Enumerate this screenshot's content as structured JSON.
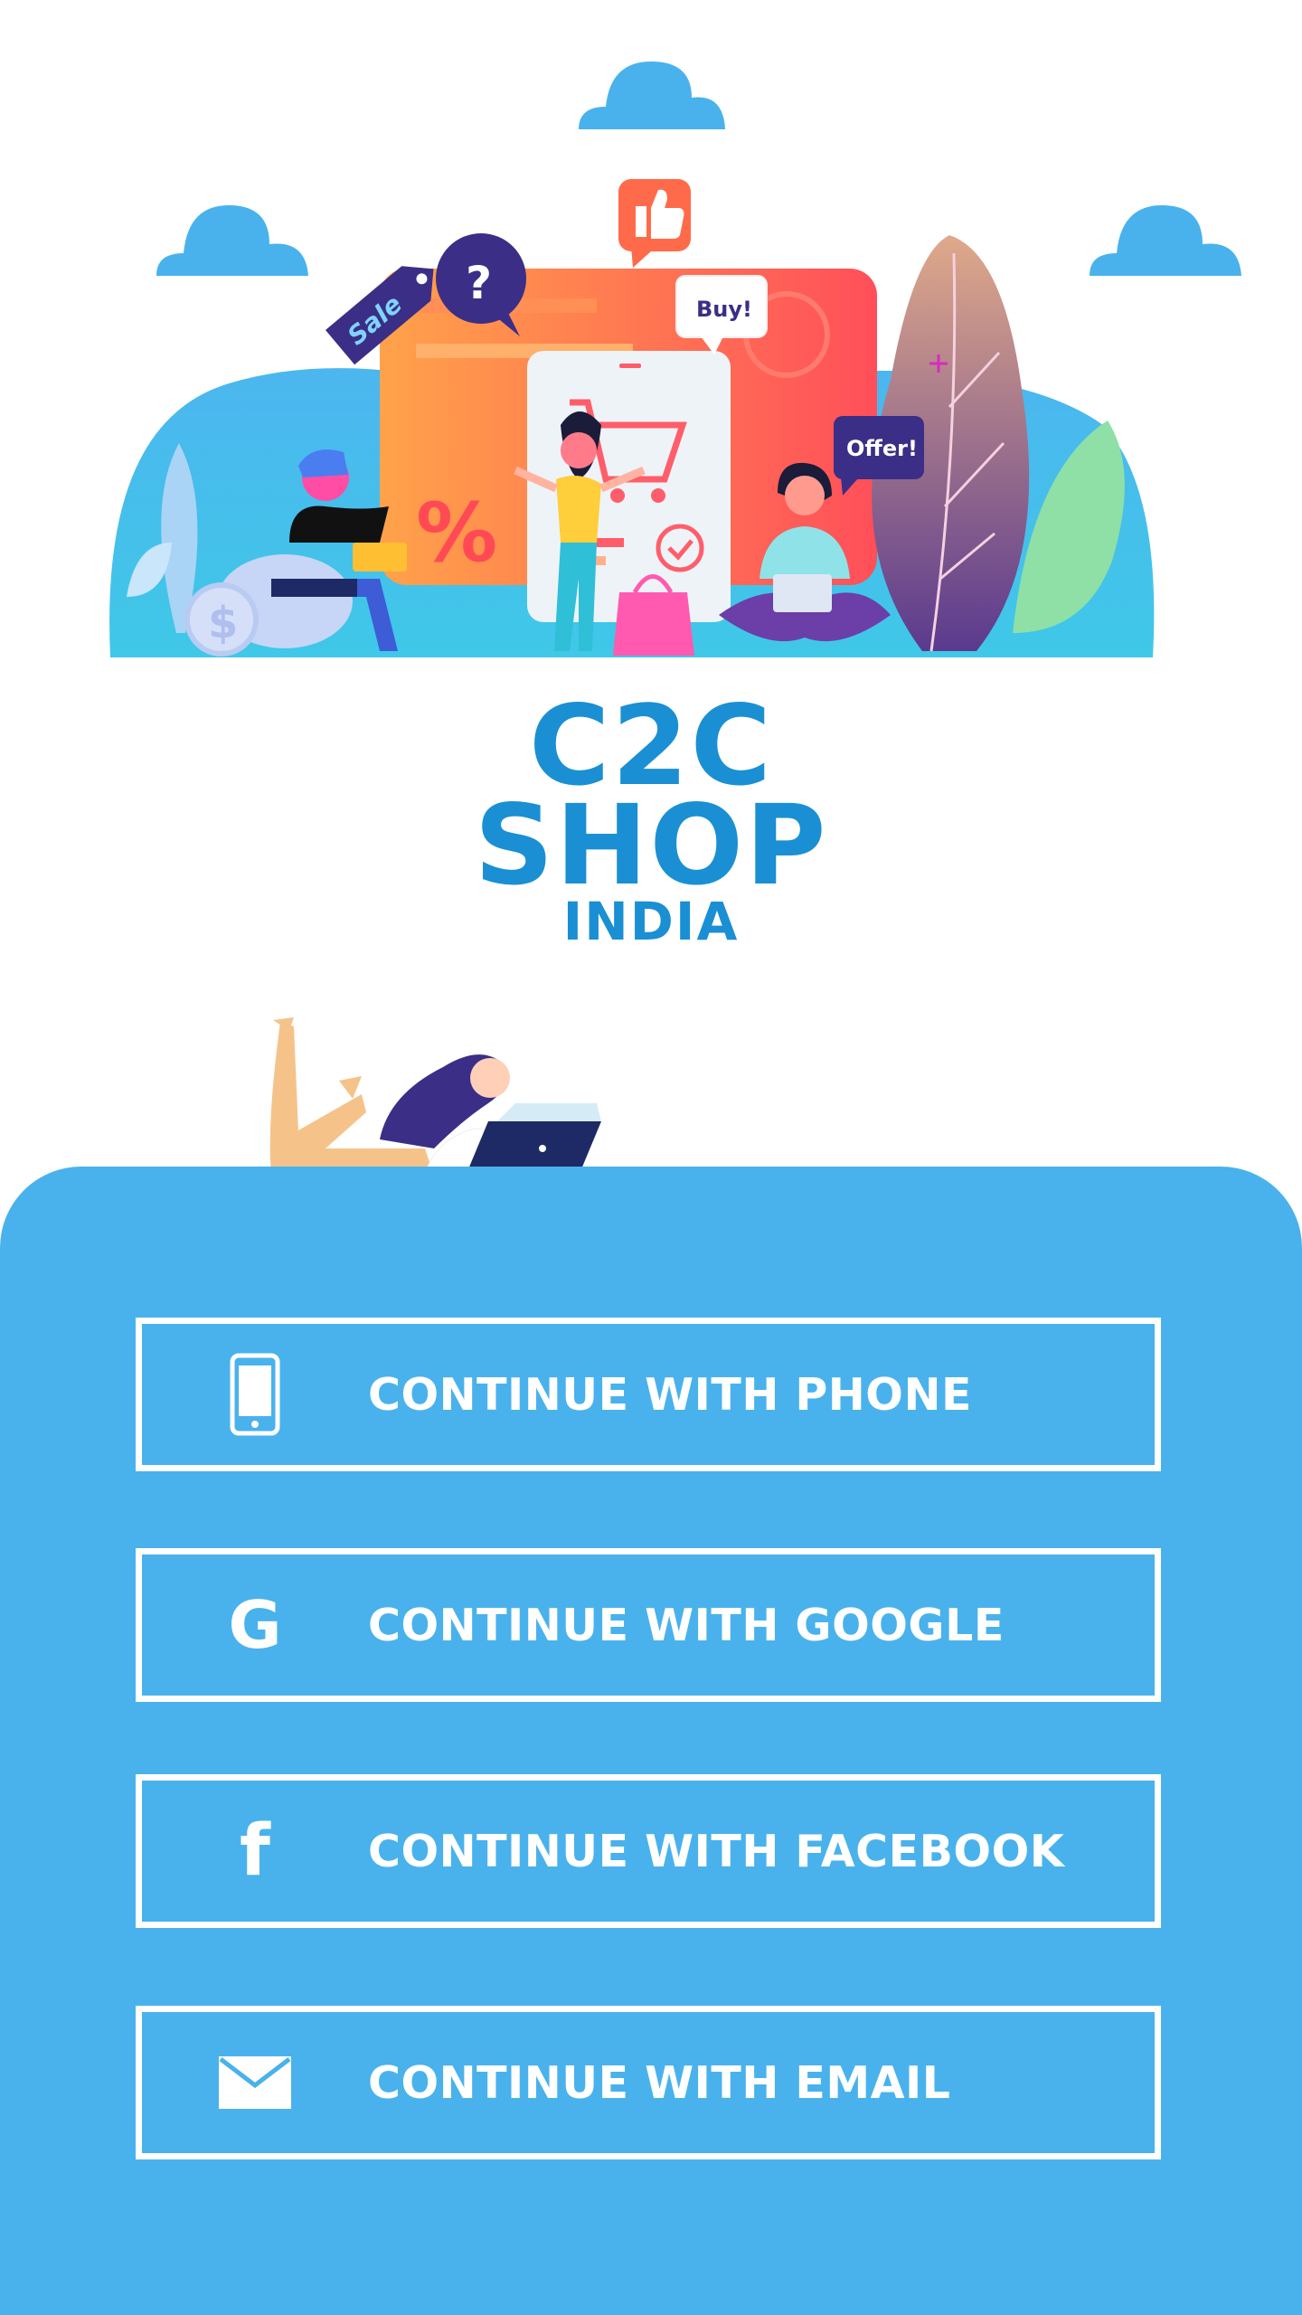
{
  "brand": {
    "line1": "C2C",
    "line2": "SHOP",
    "line3": "INDIA",
    "color": "#1a8fd3"
  },
  "illustration": {
    "tags": {
      "sale": "Sale",
      "buy": "Buy!",
      "offer": "Offer!",
      "question": "?",
      "percent": "%"
    }
  },
  "panel": {
    "color": "#49b2ec"
  },
  "buttons": [
    {
      "label": "CONTINUE WITH PHONE",
      "icon": "phone-icon"
    },
    {
      "label": "CONTINUE WITH GOOGLE",
      "icon": "google-icon",
      "glyph": "G"
    },
    {
      "label": "CONTINUE WITH FACEBOOK",
      "icon": "facebook-icon",
      "glyph": "f"
    },
    {
      "label": "CONTINUE WITH EMAIL",
      "icon": "mail-icon"
    }
  ]
}
